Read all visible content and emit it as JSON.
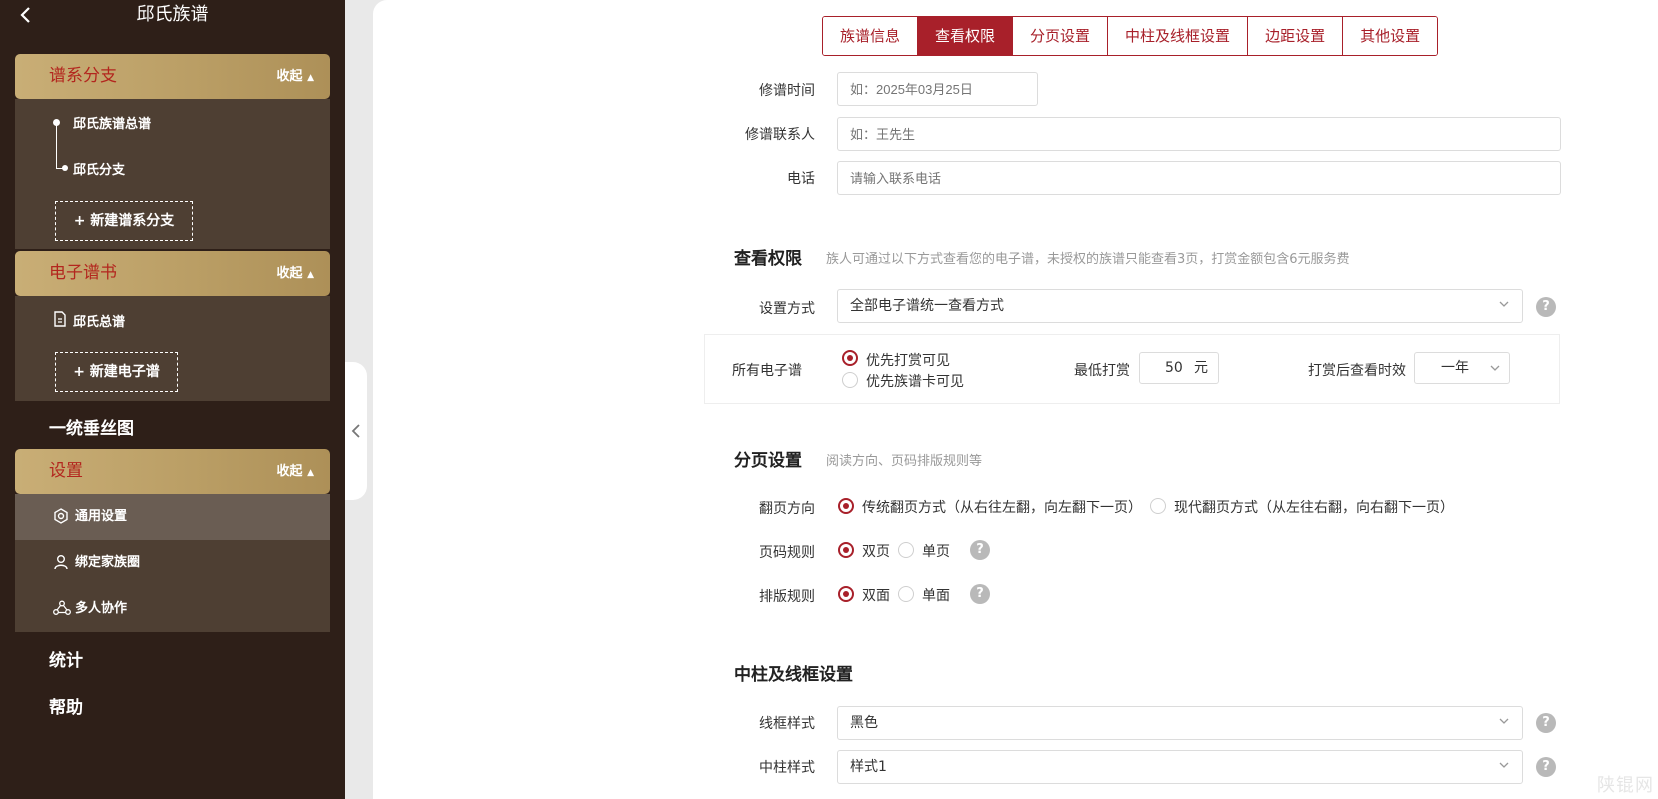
{
  "sidebar": {
    "title": "邱氏族谱",
    "sections": [
      {
        "label": "谱系分支",
        "fold": "收起"
      },
      {
        "label": "电子谱书",
        "fold": "收起"
      },
      {
        "label": "设置",
        "fold": "收起"
      }
    ],
    "branch_items": [
      "邱氏族谱总谱",
      "邱氏分支"
    ],
    "new_branch": "+ 新建谱系分支",
    "ebook_items": [
      "邱氏总谱"
    ],
    "new_ebook": "+ 新建电子谱",
    "pedigree": "一统垂丝图",
    "settings_items": [
      "通用设置",
      "绑定家族圈",
      "多人协作"
    ],
    "stats": "统计",
    "help": "帮助"
  },
  "tabs": [
    "族谱信息",
    "查看权限",
    "分页设置",
    "中柱及线框设置",
    "边距设置",
    "其他设置"
  ],
  "active_tab": "查看权限",
  "info": {
    "revise_time_label": "修谱时间",
    "revise_time_placeholder": "如：2025年03月25日",
    "contact_label": "修谱联系人",
    "contact_placeholder": "如：王先生",
    "phone_label": "电话",
    "phone_placeholder": "请输入联系电话"
  },
  "permission": {
    "title": "查看权限",
    "desc": "族人可通过以下方式查看您的电子谱，未授权的族谱只能查看3页，打赏金额包含6元服务费",
    "mode_label": "设置方式",
    "mode_value": "全部电子谱统一查看方式",
    "all_label": "所有电子谱",
    "opt1": "优先打赏可见",
    "opt2": "优先族谱卡可见",
    "min_reward_label": "最低打赏",
    "min_reward_value": "50",
    "min_reward_unit": "元",
    "validity_label": "打赏后查看时效",
    "validity_value": "一年"
  },
  "paging": {
    "title": "分页设置",
    "desc": "阅读方向、页码排版规则等",
    "direction_label": "翻页方向",
    "direction_opt1": "传统翻页方式（从右往左翻，向左翻下一页）",
    "direction_opt2": "现代翻页方式（从左往右翻，向右翻下一页）",
    "pageno_label": "页码规则",
    "pageno_opt1": "双页",
    "pageno_opt2": "单页",
    "layout_label": "排版规则",
    "layout_opt1": "双面",
    "layout_opt2": "单面"
  },
  "pillar": {
    "title": "中柱及线框设置",
    "frame_label": "线框样式",
    "frame_value": "黑色",
    "pillar_label": "中柱样式",
    "pillar_value": "样式1"
  },
  "help_glyph": "?",
  "watermark": "陕锟网",
  "colors": {
    "accent": "#a8202a",
    "sidebar_bg": "#2e1f18",
    "section_gold": "#c0a46b"
  }
}
